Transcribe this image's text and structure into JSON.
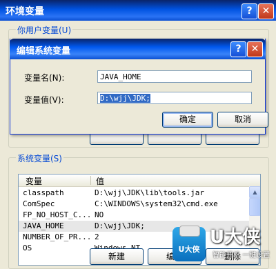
{
  "back_window": {
    "title": "环境变量",
    "help_glyph": "?",
    "close_glyph": "✕",
    "user_group_label": "你用户变量(U)"
  },
  "edit_dialog": {
    "title": "编辑系统变量",
    "help_glyph": "?",
    "close_glyph": "✕",
    "name_label": "变量名(N):",
    "name_value": "JAVA_HOME",
    "value_label": "变量值(V):",
    "value_value": "D:\\wjj\\JDK;",
    "ok_label": "确定",
    "cancel_label": "取消"
  },
  "system_vars": {
    "group_label": "系统变量(S)",
    "columns": [
      "变量",
      "值"
    ],
    "rows": [
      {
        "name": "classpath",
        "value": "D:\\wjj\\JDK\\lib\\tools.jar"
      },
      {
        "name": "ComSpec",
        "value": "C:\\WINDOWS\\system32\\cmd.exe"
      },
      {
        "name": "FP_NO_HOST_C...",
        "value": "NO"
      },
      {
        "name": "JAVA_HOME",
        "value": "D:\\wjj\\JDK;"
      },
      {
        "name": "NUMBER_OF_PR...",
        "value": "2"
      },
      {
        "name": "OS",
        "value": "Windows_NT"
      }
    ],
    "selected_row": 3,
    "new_label": "新建",
    "edit_label": "编辑",
    "delete_label": "删除"
  },
  "watermark": {
    "badge_text": "U大侠",
    "main_text": "U大侠",
    "sub_text": "智能开机 一键设置"
  },
  "colors": {
    "titlebar_blue": "#0058ee",
    "selection_blue": "#316ac5",
    "group_label_blue": "#0046d5",
    "window_bg": "#ece9d8"
  }
}
